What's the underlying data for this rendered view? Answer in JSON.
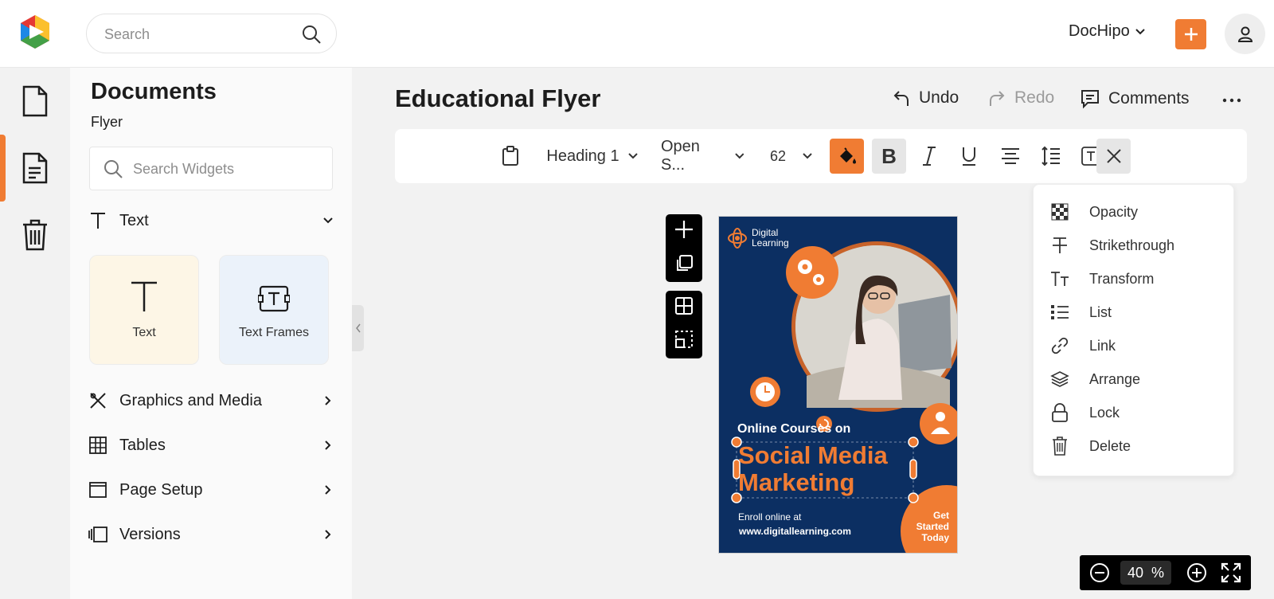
{
  "brand": {
    "accent": "#f07c33",
    "flyer_bg": "#0c2f62"
  },
  "topbar": {
    "search_placeholder": "Search",
    "account_name": "DocHipo"
  },
  "sidebar_rail": {
    "items": [
      {
        "icon": "document-icon",
        "active": false
      },
      {
        "icon": "file-text-icon",
        "active": true
      },
      {
        "icon": "trash-icon",
        "active": false
      }
    ]
  },
  "panel": {
    "title": "Documents",
    "subtitle": "Flyer",
    "widget_search_placeholder": "Search Widgets",
    "text_section": {
      "label": "Text",
      "tiles": [
        "Text",
        "Text Frames"
      ]
    },
    "sections": [
      "Graphics and Media",
      "Tables",
      "Page Setup",
      "Versions"
    ]
  },
  "document": {
    "title": "Educational Flyer",
    "undo": "Undo",
    "redo": "Redo",
    "comments": "Comments"
  },
  "toolbar": {
    "style": "Heading 1",
    "font": "Open S...",
    "size": "62"
  },
  "flyer": {
    "brand_line1": "Digital",
    "brand_line2": "Learning",
    "kicker": "Online Courses on",
    "headline_line1": "Social Media",
    "headline_line2": "Marketing",
    "enroll": "Enroll online at",
    "url": "www.digitallearning.com",
    "cta_line1": "Get",
    "cta_line2": "Started",
    "cta_line3": "Today"
  },
  "menu": {
    "items": [
      {
        "label": "Opacity",
        "icon": "checkerboard-icon"
      },
      {
        "label": "Strikethrough",
        "icon": "strikethrough-icon"
      },
      {
        "label": "Transform",
        "icon": "text-case-icon"
      },
      {
        "label": "List",
        "icon": "list-icon"
      },
      {
        "label": "Link",
        "icon": "link-icon"
      },
      {
        "label": "Arrange",
        "icon": "layers-icon"
      },
      {
        "label": "Lock",
        "icon": "lock-icon"
      },
      {
        "label": "Delete",
        "icon": "trash-icon"
      }
    ]
  },
  "zoom": {
    "value": "40",
    "unit": "%"
  }
}
